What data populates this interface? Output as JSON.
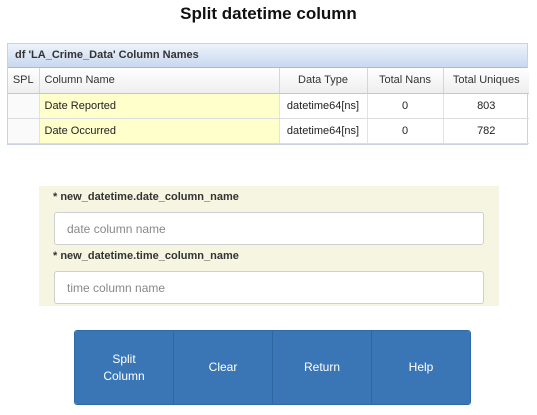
{
  "page": {
    "title": "Split datetime column"
  },
  "grid": {
    "caption": "df 'LA_Crime_Data' Column Names",
    "headers": [
      "SPL",
      "Column Name",
      "Data Type",
      "Total Nans",
      "Total Uniques"
    ],
    "rows": [
      {
        "spl": "",
        "name": "Date Reported",
        "dtype": "datetime64[ns]",
        "nans": "0",
        "uniques": "803"
      },
      {
        "spl": "",
        "name": "Date Occurred",
        "dtype": "datetime64[ns]",
        "nans": "0",
        "uniques": "782"
      }
    ]
  },
  "form": {
    "date_label": "* new_datetime.date_column_name",
    "date_value": "",
    "date_placeholder": "date column name",
    "time_label": "* new_datetime.time_column_name",
    "time_value": "",
    "time_placeholder": "time column name"
  },
  "buttons": {
    "split": "Split\nColumn",
    "clear": "Clear",
    "return": "Return",
    "help": "Help"
  },
  "colors": {
    "button_bg": "#3a76b5",
    "panel_bg": "#f5f5e2",
    "highlight_cell": "#ffffcc"
  }
}
